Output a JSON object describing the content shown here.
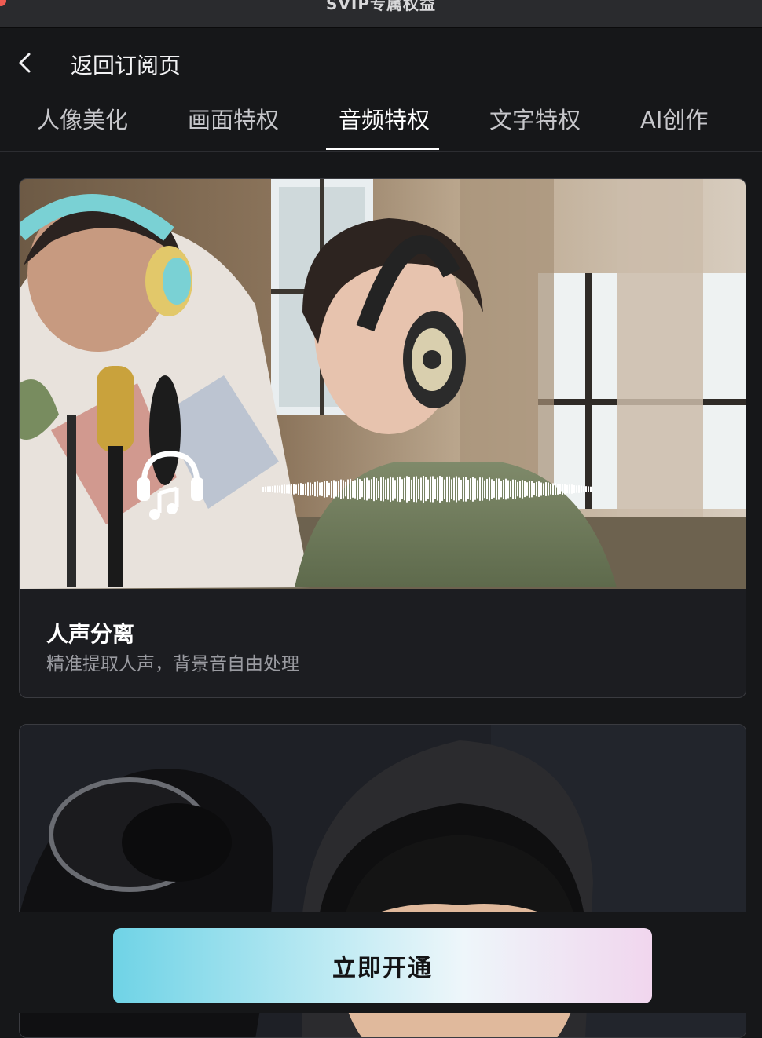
{
  "window": {
    "title": "SVIP专属权益"
  },
  "nav": {
    "back_label": "返回订阅页"
  },
  "tabs": [
    {
      "label": "人像美化",
      "active": false
    },
    {
      "label": "画面特权",
      "active": false
    },
    {
      "label": "音频特权",
      "active": true
    },
    {
      "label": "文字特权",
      "active": false
    },
    {
      "label": "AI创作",
      "active": false
    }
  ],
  "cards": [
    {
      "title": "人声分离",
      "description": "精准提取人声，背景音自由处理",
      "media_icon": "headphones-music-icon"
    }
  ],
  "cta": {
    "label": "立即开通"
  },
  "colors": {
    "background": "#161719",
    "cta_start": "#6fd3e6",
    "cta_end": "#f1d6ee"
  }
}
